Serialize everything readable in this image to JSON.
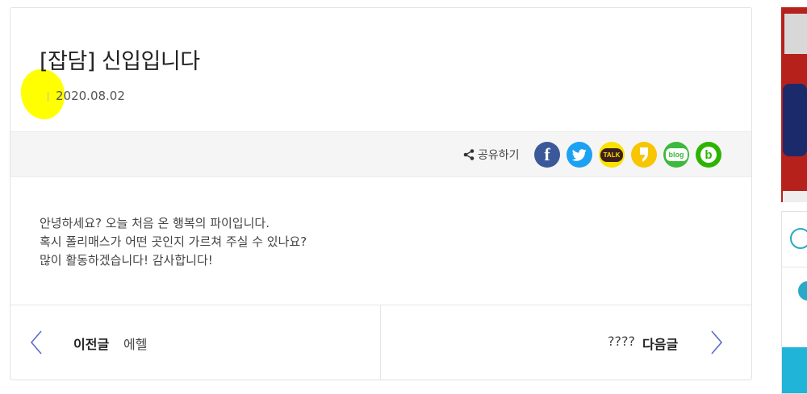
{
  "post": {
    "title": "[잡담] 신입입니다",
    "date": "2020.08.02"
  },
  "share": {
    "label": "공유하기",
    "icons": [
      {
        "name": "facebook-icon",
        "color": "#3b5998",
        "glyph": "f"
      },
      {
        "name": "twitter-icon",
        "color": "#1da1f2",
        "glyph": ""
      },
      {
        "name": "kakaotalk-icon",
        "color": "#fae100",
        "glyph": "TALK"
      },
      {
        "name": "kakaostory-icon",
        "color": "#f7c600",
        "glyph": ""
      },
      {
        "name": "naver-blog-icon",
        "color": "#3db93d",
        "glyph": "blog"
      },
      {
        "name": "band-icon",
        "color": "#2db400",
        "glyph": "b"
      }
    ]
  },
  "content": {
    "lines": [
      "안녕하세요? 오늘 처음 온 행복의 파이입니다.",
      "혹시 폴리매스가 어떤 곳인지 가르쳐 주실 수 있나요?",
      "많이 활동하겠습니다! 감사합니다!"
    ]
  },
  "nav": {
    "prev_label": "이전글",
    "prev_title": "에헬",
    "next_label": "다음글",
    "next_title": "????"
  },
  "colors": {
    "highlight": "#ffff00",
    "nav_arrow": "#5b6dc8"
  }
}
